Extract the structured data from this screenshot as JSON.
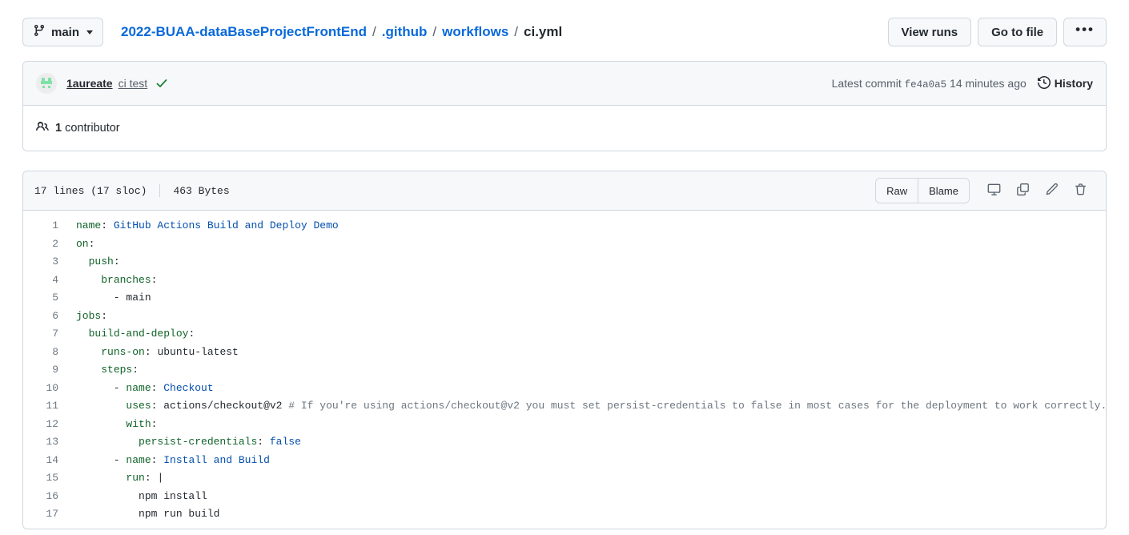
{
  "topbar": {
    "branch": {
      "label": "main",
      "icon": "git-branch-icon",
      "caret": "chevron-down-icon"
    },
    "breadcrumb": {
      "repo": "2022-BUAA-dataBaseProjectFrontEnd",
      "parts": [
        ".github",
        "workflows"
      ],
      "current": "ci.yml",
      "separator": "/"
    },
    "actions": {
      "view_runs": "View runs",
      "go_to_file": "Go to file",
      "kebab": "•••"
    }
  },
  "commit": {
    "avatar": "user-avatar",
    "author": "1aureate",
    "message": "ci test",
    "status_icon": "check-icon",
    "latest_commit_label": "Latest commit",
    "hash": "fe4a0a5",
    "time": "14 minutes ago",
    "history_label": "History",
    "history_icon": "history-icon"
  },
  "contributors": {
    "icon": "people-icon",
    "count": "1",
    "label": "contributor"
  },
  "file": {
    "lines_text": "17 lines (17 sloc)",
    "size_text": "463 Bytes",
    "actions": {
      "raw": "Raw",
      "blame": "Blame",
      "open_desktop_icon": "desktop-download-icon",
      "copy_icon": "copy-icon",
      "edit_icon": "pencil-icon",
      "delete_icon": "trash-icon"
    }
  },
  "code": {
    "language": "yaml",
    "lines": [
      {
        "n": "1",
        "tokens": [
          {
            "t": "key",
            "v": "name"
          },
          {
            "t": "pun",
            "v": ": "
          },
          {
            "t": "val",
            "v": "GitHub Actions Build and Deploy Demo"
          }
        ]
      },
      {
        "n": "2",
        "tokens": [
          {
            "t": "key",
            "v": "on"
          },
          {
            "t": "pun",
            "v": ":"
          }
        ]
      },
      {
        "n": "3",
        "tokens": [
          {
            "t": "pun",
            "v": "  "
          },
          {
            "t": "key",
            "v": "push"
          },
          {
            "t": "pun",
            "v": ":"
          }
        ]
      },
      {
        "n": "4",
        "tokens": [
          {
            "t": "pun",
            "v": "    "
          },
          {
            "t": "key",
            "v": "branches"
          },
          {
            "t": "pun",
            "v": ":"
          }
        ]
      },
      {
        "n": "5",
        "tokens": [
          {
            "t": "pun",
            "v": "      - "
          },
          {
            "t": "str",
            "v": "main"
          }
        ]
      },
      {
        "n": "6",
        "tokens": [
          {
            "t": "key",
            "v": "jobs"
          },
          {
            "t": "pun",
            "v": ":"
          }
        ]
      },
      {
        "n": "7",
        "tokens": [
          {
            "t": "pun",
            "v": "  "
          },
          {
            "t": "key",
            "v": "build-and-deploy"
          },
          {
            "t": "pun",
            "v": ":"
          }
        ]
      },
      {
        "n": "8",
        "tokens": [
          {
            "t": "pun",
            "v": "    "
          },
          {
            "t": "key",
            "v": "runs-on"
          },
          {
            "t": "pun",
            "v": ": "
          },
          {
            "t": "str",
            "v": "ubuntu-latest"
          }
        ]
      },
      {
        "n": "9",
        "tokens": [
          {
            "t": "pun",
            "v": "    "
          },
          {
            "t": "key",
            "v": "steps"
          },
          {
            "t": "pun",
            "v": ":"
          }
        ]
      },
      {
        "n": "10",
        "tokens": [
          {
            "t": "pun",
            "v": "      - "
          },
          {
            "t": "key",
            "v": "name"
          },
          {
            "t": "pun",
            "v": ": "
          },
          {
            "t": "val",
            "v": "Checkout"
          }
        ]
      },
      {
        "n": "11",
        "tokens": [
          {
            "t": "pun",
            "v": "        "
          },
          {
            "t": "key",
            "v": "uses"
          },
          {
            "t": "pun",
            "v": ": "
          },
          {
            "t": "str",
            "v": "actions/checkout@v2 "
          },
          {
            "t": "com",
            "v": "# If you're using actions/checkout@v2 you must set persist-credentials to false in most cases for the deployment to work correctly."
          }
        ]
      },
      {
        "n": "12",
        "tokens": [
          {
            "t": "pun",
            "v": "        "
          },
          {
            "t": "key",
            "v": "with"
          },
          {
            "t": "pun",
            "v": ":"
          }
        ]
      },
      {
        "n": "13",
        "tokens": [
          {
            "t": "pun",
            "v": "          "
          },
          {
            "t": "key",
            "v": "persist-credentials"
          },
          {
            "t": "pun",
            "v": ": "
          },
          {
            "t": "val",
            "v": "false"
          }
        ]
      },
      {
        "n": "14",
        "tokens": [
          {
            "t": "pun",
            "v": "      - "
          },
          {
            "t": "key",
            "v": "name"
          },
          {
            "t": "pun",
            "v": ": "
          },
          {
            "t": "val",
            "v": "Install and Build"
          }
        ]
      },
      {
        "n": "15",
        "tokens": [
          {
            "t": "pun",
            "v": "        "
          },
          {
            "t": "key",
            "v": "run"
          },
          {
            "t": "pun",
            "v": ": "
          },
          {
            "t": "str",
            "v": "|"
          }
        ]
      },
      {
        "n": "16",
        "tokens": [
          {
            "t": "pun",
            "v": "          "
          },
          {
            "t": "str",
            "v": "npm install"
          }
        ]
      },
      {
        "n": "17",
        "tokens": [
          {
            "t": "pun",
            "v": "          "
          },
          {
            "t": "str",
            "v": "npm run build"
          }
        ]
      }
    ]
  },
  "colors": {
    "link": "#0969da",
    "border": "#d0d7de",
    "surface": "#f6f8fa",
    "text": "#24292f",
    "muted": "#57606a",
    "key": "#116329",
    "value": "#0550ae",
    "comment": "#6e7781",
    "success": "#1a7f37"
  }
}
